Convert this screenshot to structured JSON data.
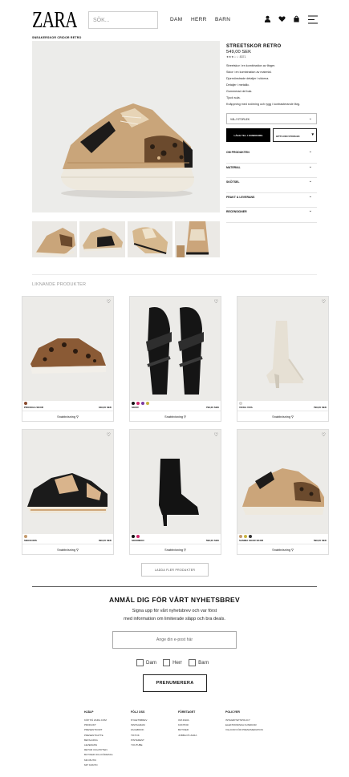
{
  "header": {
    "logo": "ZARA",
    "search_placeholder": "SÖK...",
    "nav": [
      "DAM",
      "HERR",
      "BARN"
    ]
  },
  "breadcrumb": "SNEAKERSKOR CRIDOR RETRO",
  "product": {
    "title": "STREETSKOR RETRO",
    "price": "549,00 SEK",
    "rating": "★★★☆☆  8371",
    "description": [
      "Streetskor i en kombination av färger.",
      "Sidor i en kombination av material.",
      "Djurmönstrade detaljer i sidorna.",
      "Detaljer i metallic.",
      "Gummerad del bak.",
      "Tjock sula.",
      "Knäppning med snörning och rygg i kontrasterande färg."
    ],
    "size_select": "VÄLJ STORLEK",
    "add_button": "LÄGG TILL I KUNDKORG",
    "find_button": "HITTA DIN STORLEK",
    "accordion": [
      "OM PRODUKTEN",
      "MATERIAL",
      "SKÖTSEL",
      "FRAKT & LEVERANS",
      "RECENSIONER"
    ]
  },
  "similar": {
    "title": "LIKNANDE PRODUKTER",
    "button_label": "Snabbvisning",
    "products": [
      {
        "name": "PRICKIGA SKOR",
        "price": "349,00 SEK",
        "swatches": [
          "#8a4b2f"
        ]
      },
      {
        "name": "SKOR",
        "price": "799,00 SEK",
        "swatches": [
          "#111111",
          "#d0286a",
          "#7c3aa0",
          "#c8b440"
        ]
      },
      {
        "name": "VICKA VIVA",
        "price": "799,00 SEK",
        "swatches": [
          "#e8e3d8"
        ]
      },
      {
        "name": "SNICKORS",
        "price": "399,00 SEK",
        "swatches": [
          "#c49a6c"
        ]
      },
      {
        "name": "SKORMAN",
        "price": "599,00 SEK",
        "swatches": [
          "#111111",
          "#d0286a"
        ]
      },
      {
        "name": "SAMMA SKOR SKOR",
        "price": "599,00 SEK",
        "swatches": [
          "#c49a6c",
          "#c8b440",
          "#333333"
        ]
      }
    ],
    "more_button": "LADDA FLER PRODUKTER"
  },
  "newsletter": {
    "title": "ANMÄL DIG FÖR VÅRT NYHETSBREV",
    "text_line1": "Signa upp för vårt nyhetsbrev och var först",
    "text_line2": "med information om limiterade släpp och bra deals.",
    "email_placeholder": "Ange din e-post här",
    "checks": [
      "Dam",
      "Herr",
      "Barn"
    ],
    "submit": "PRENUMERERA"
  },
  "footer": {
    "columns": [
      {
        "title": "HJÄLP",
        "links": [
          "KÖP PÅ ZARA.COM",
          "PRODUKT",
          "PRESENTKORT",
          "PRESENTKATTE",
          "BETALNING",
          "LEVERANS",
          "RETUR OCH BYTEN",
          "BUTIKER OCH FÖRETAG",
          "MIN BUTIK",
          "MIT KONTO"
        ]
      },
      {
        "title": "FÖLJ OSS",
        "links": [
          "NYHETSBREV",
          "INSTAGRAM",
          "FACEBOOK",
          "TIKTOK",
          "PINTEREST",
          "YOUTUBE"
        ]
      },
      {
        "title": "FÖRETAGET",
        "links": [
          "OM ZARA",
          "KONTOR",
          "BUTIKER",
          "JOBBA PÅ ZARA"
        ]
      },
      {
        "title": "POLICYER",
        "links": [
          "INTEGRITETSPOLICY",
          "ELEKTRONISKA KUNDKOR",
          "VILLKOR FÖR PRENUMERATION"
        ]
      }
    ]
  }
}
